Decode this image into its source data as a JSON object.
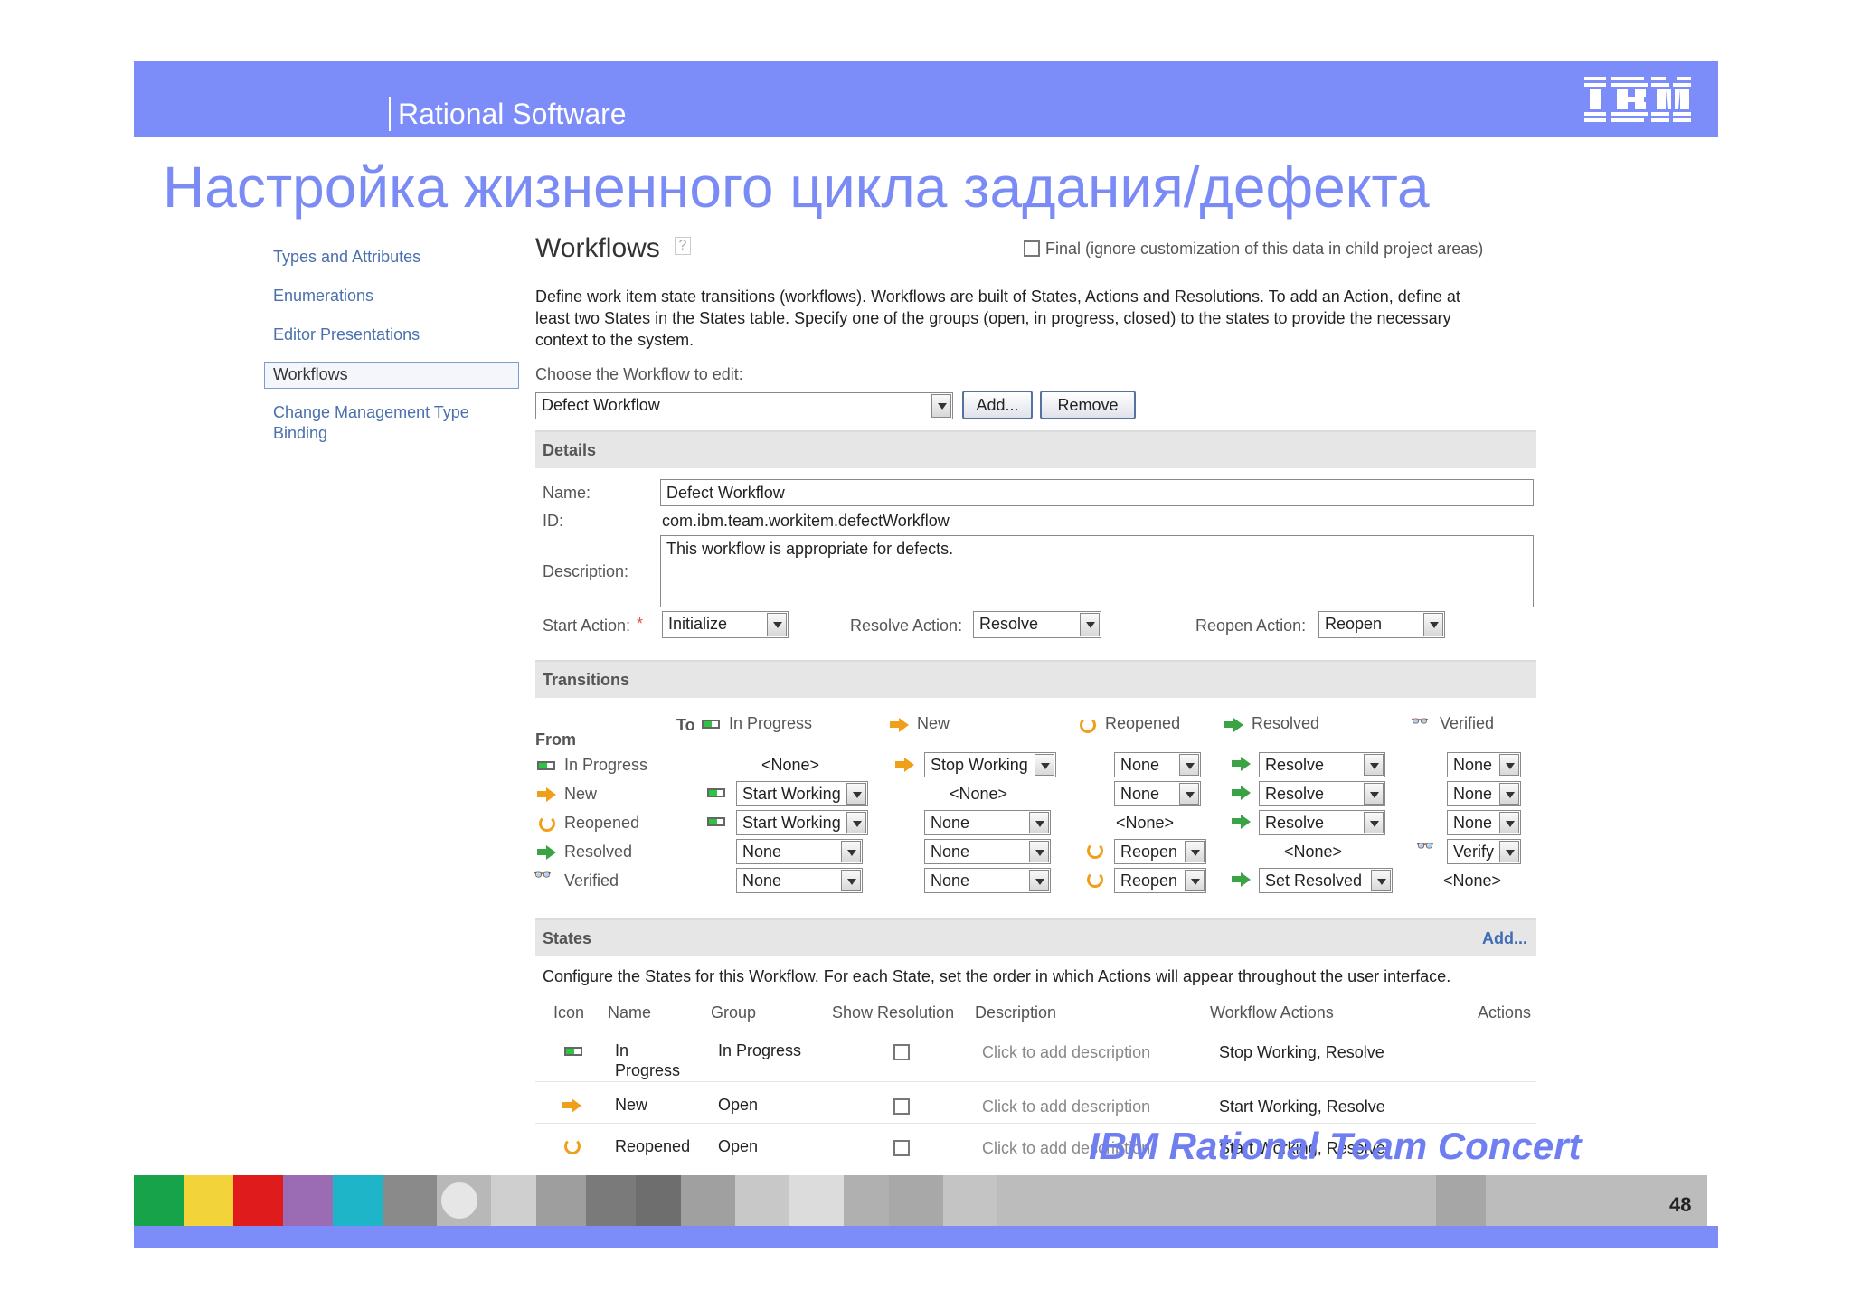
{
  "header": {
    "brand": "Rational Software",
    "logo": "IBM"
  },
  "slide_title": "Настройка жизненного цикла задания/дефекта",
  "nav": {
    "items": [
      "Types and Attributes",
      "Enumerations",
      "Editor Presentations",
      "Workflows"
    ],
    "item_cmt_line1": "Change Management Type",
    "item_cmt_line2": "Binding",
    "selected": "Workflows"
  },
  "workflows": {
    "heading": "Workflows",
    "help_icon": "?",
    "final_label": "Final (ignore customization of this data in child project areas)",
    "final_checked": false,
    "intro_l1": "Define work item state transitions (workflows). Workflows are built of States, Actions and Resolutions. To add an Action, define at",
    "intro_l2": "least two States in the States table. Specify one of the groups (open, in progress, closed) to the states to provide the necessary",
    "intro_l3": "context to the system.",
    "choose_label": "Choose the Workflow to edit:",
    "selected_workflow": "Defect Workflow",
    "add_button": "Add...",
    "remove_button": "Remove"
  },
  "details": {
    "section_title": "Details",
    "name_label": "Name:",
    "name_value": "Defect Workflow",
    "id_label": "ID:",
    "id_value": "com.ibm.team.workitem.defectWorkflow",
    "description_label": "Description:",
    "description_value": "This workflow is appropriate for defects.",
    "start_action_label": "Start Action:",
    "required_mark": "*",
    "start_action_value": "Initialize",
    "resolve_action_label": "Resolve Action:",
    "resolve_action_value": "Resolve",
    "reopen_action_label": "Reopen Action:",
    "reopen_action_value": "Reopen"
  },
  "transitions": {
    "section_title": "Transitions",
    "to_label": "To",
    "from_label": "From",
    "columns": [
      "In Progress",
      "New",
      "Reopened",
      "Resolved",
      "Verified"
    ],
    "rows": [
      {
        "from": "In Progress",
        "cells": [
          "<None>",
          "Stop Working",
          "None",
          "Resolve",
          "None"
        ]
      },
      {
        "from": "New",
        "cells": [
          "Start Working",
          "<None>",
          "None",
          "Resolve",
          "None"
        ]
      },
      {
        "from": "Reopened",
        "cells": [
          "Start Working",
          "None",
          "<None>",
          "Resolve",
          "None"
        ]
      },
      {
        "from": "Resolved",
        "cells": [
          "None",
          "None",
          "Reopen",
          "<None>",
          "Verify"
        ]
      },
      {
        "from": "Verified",
        "cells": [
          "None",
          "None",
          "Reopen",
          "Set Resolved",
          "<None>"
        ]
      }
    ]
  },
  "states": {
    "section_title": "States",
    "add_link": "Add...",
    "description": "Configure the States for this Workflow. For each State, set the order in which Actions will appear throughout the user interface.",
    "columns": [
      "Icon",
      "Name",
      "Group",
      "Show Resolution",
      "Description",
      "Workflow Actions",
      "Actions"
    ],
    "rows": [
      {
        "name_l1": "In",
        "name_l2": "Progress",
        "group": "In Progress",
        "description": "Click to add description",
        "actions": "Stop Working, Resolve"
      },
      {
        "name_l1": "New",
        "name_l2": "",
        "group": "Open",
        "description": "Click to add description",
        "actions": "Start Working, Resolve"
      },
      {
        "name_l1": "Reopened",
        "name_l2": "",
        "group": "Open",
        "description": "Click to add description",
        "actions": "Start Working, Resolve"
      }
    ]
  },
  "footer": {
    "product": "IBM Rational Team Concert",
    "page_number": "48"
  },
  "colors": {
    "accent": "#7c8cf9",
    "link": "#4a70ad",
    "green": "#3aa345",
    "orange": "#f0a018"
  }
}
